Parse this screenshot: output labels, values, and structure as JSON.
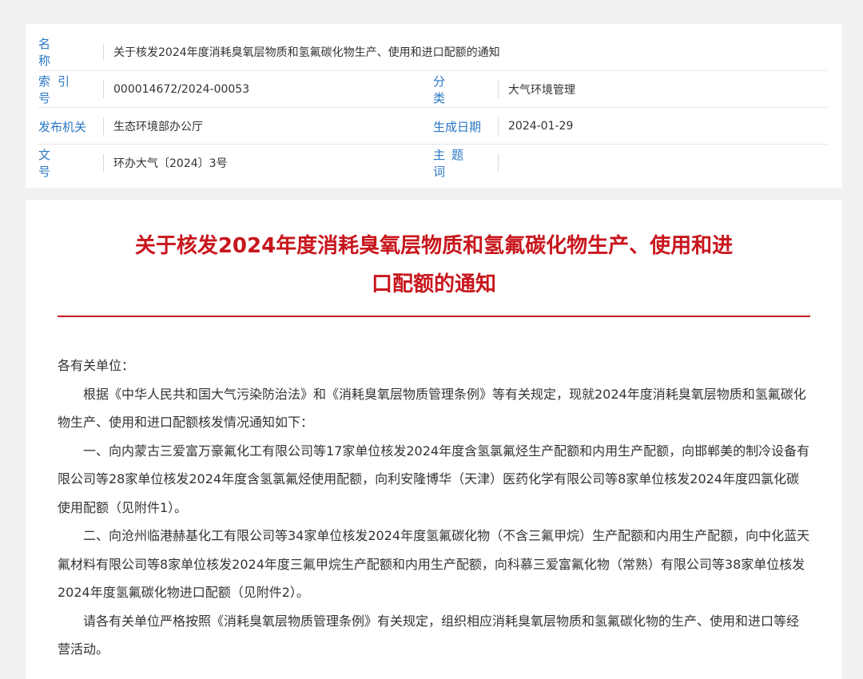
{
  "meta": {
    "name_label": "名称",
    "name_value": "关于核发2024年度消耗臭氧层物质和氢氟碳化物生产、使用和进口配额的通知",
    "index_label": "索引号",
    "index_value": "000014672/2024-00053",
    "category_label": "分类",
    "category_value": "大气环境管理",
    "issuer_label": "发布机关",
    "issuer_value": "生态环境部办公厅",
    "date_label": "生成日期",
    "date_value": "2024-01-29",
    "doc_no_label": "文号",
    "doc_no_value": "环办大气〔2024〕3号",
    "keywords_label": "主题词",
    "keywords_value": ""
  },
  "article": {
    "title_line1": "关于核发2024年度消耗臭氧层物质和氢氟碳化物生产、使用和进",
    "title_line2": "口配额的通知",
    "salutation": "各有关单位：",
    "p1": "根据《中华人民共和国大气污染防治法》和《消耗臭氧层物质管理条例》等有关规定，现就2024年度消耗臭氧层物质和氢氟碳化物生产、使用和进口配额核发情况通知如下：",
    "p2": "一、向内蒙古三爱富万豪氟化工有限公司等17家单位核发2024年度含氢氯氟烃生产配额和内用生产配额，向邯郸美的制冷设备有限公司等28家单位核发2024年度含氢氯氟烃使用配额，向利安隆博华（天津）医药化学有限公司等8家单位核发2024年度四氯化碳使用配额（见附件1）。",
    "p3": "二、向沧州临港赫基化工有限公司等34家单位核发2024年度氢氟碳化物（不含三氟甲烷）生产配额和内用生产配额，向中化蓝天氟材料有限公司等8家单位核发2024年度三氟甲烷生产配额和内用生产配额，向科慕三爱富氟化物（常熟）有限公司等38家单位核发2024年度氢氟碳化物进口配额（见附件2）。",
    "p4": "请各有关单位严格按照《消耗臭氧层物质管理条例》有关规定，组织相应消耗臭氧层物质和氢氟碳化物的生产、使用和进口等经营活动。"
  }
}
